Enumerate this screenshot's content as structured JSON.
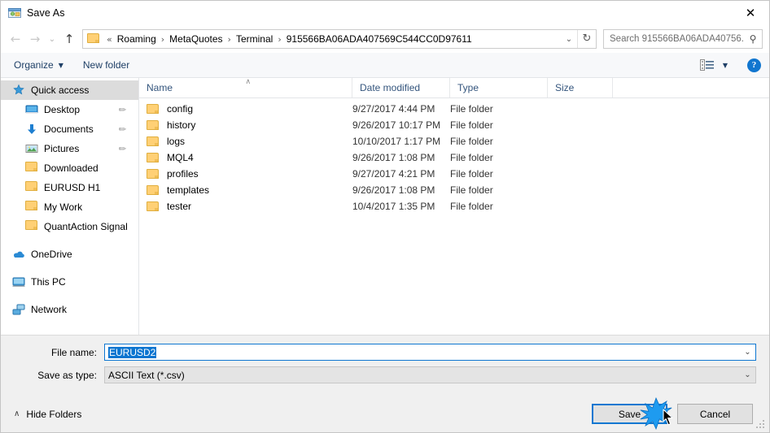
{
  "window": {
    "title": "Save As",
    "title_icon": "save-as-app-icon",
    "close_label": "✕"
  },
  "nav": {
    "back_icon": "←",
    "forward_icon": "→",
    "recent_icon": "⌄",
    "up_icon": "↑",
    "folder_icon": "folder-icon",
    "prefix": "«",
    "separator": "›",
    "breadcrumbs": [
      "Roaming",
      "MetaQuotes",
      "Terminal",
      "915566BA06ADA407569C544CC0D97611"
    ],
    "dropdown_icon": "⌄",
    "refresh_icon": "↻"
  },
  "search": {
    "placeholder": "Search 915566BA06ADA40756...",
    "icon": "⚲"
  },
  "toolbar": {
    "organize_label": "Organize",
    "organize_caret": "▼",
    "new_folder_label": "New folder",
    "view_icon": "view-options-icon",
    "view_caret": "▼",
    "help_label": "?"
  },
  "sidebar": {
    "items": [
      {
        "label": "Quick access",
        "icon": "star-icon",
        "level": "root",
        "selected": true,
        "pinned": false
      },
      {
        "label": "Desktop",
        "icon": "desktop-icon",
        "level": "child",
        "selected": false,
        "pinned": true
      },
      {
        "label": "Documents",
        "icon": "documents-download-icon",
        "level": "child",
        "selected": false,
        "pinned": true
      },
      {
        "label": "Pictures",
        "icon": "pictures-icon",
        "level": "child",
        "selected": false,
        "pinned": true
      },
      {
        "label": "Downloaded",
        "icon": "folder-icon",
        "level": "child",
        "selected": false,
        "pinned": false
      },
      {
        "label": "EURUSD H1",
        "icon": "folder-icon",
        "level": "child",
        "selected": false,
        "pinned": false
      },
      {
        "label": "My Work",
        "icon": "folder-icon",
        "level": "child",
        "selected": false,
        "pinned": false
      },
      {
        "label": "QuantAction Signal",
        "icon": "folder-icon",
        "level": "child",
        "selected": false,
        "pinned": false
      },
      {
        "label": "OneDrive",
        "icon": "onedrive-cloud-icon",
        "level": "root",
        "selected": false,
        "pinned": false,
        "gap_before": true
      },
      {
        "label": "This PC",
        "icon": "this-pc-icon",
        "level": "root",
        "selected": false,
        "pinned": false,
        "gap_before": true
      },
      {
        "label": "Network",
        "icon": "network-icon",
        "level": "root",
        "selected": false,
        "pinned": false,
        "gap_before": true
      }
    ],
    "pin_glyph": "✐"
  },
  "filelist": {
    "columns": [
      "Name",
      "Date modified",
      "Type",
      "Size"
    ],
    "sort_caret": "∧",
    "rows": [
      {
        "name": "config",
        "date": "9/27/2017 4:44 PM",
        "type": "File folder",
        "size": ""
      },
      {
        "name": "history",
        "date": "9/26/2017 10:17 PM",
        "type": "File folder",
        "size": ""
      },
      {
        "name": "logs",
        "date": "10/10/2017 1:17 PM",
        "type": "File folder",
        "size": ""
      },
      {
        "name": "MQL4",
        "date": "9/26/2017 1:08 PM",
        "type": "File folder",
        "size": ""
      },
      {
        "name": "profiles",
        "date": "9/27/2017 4:21 PM",
        "type": "File folder",
        "size": ""
      },
      {
        "name": "templates",
        "date": "9/26/2017 1:08 PM",
        "type": "File folder",
        "size": ""
      },
      {
        "name": "tester",
        "date": "10/4/2017 1:35 PM",
        "type": "File folder",
        "size": ""
      }
    ]
  },
  "form": {
    "file_name_label": "File name:",
    "file_name_value": "EURUSD2",
    "save_as_type_label": "Save as type:",
    "save_as_type_value": "ASCII Text (*.csv)",
    "caret": "⌄"
  },
  "footer": {
    "hide_folders_label": "Hide Folders",
    "hide_folders_caret": "∧",
    "save_label": "Save",
    "cancel_label": "Cancel"
  },
  "colors": {
    "accent": "#0e77d1",
    "selection": "#0b75d0",
    "folder": "#ffd075",
    "header_text": "#34557d",
    "toolbar_text": "#1e3f66"
  }
}
